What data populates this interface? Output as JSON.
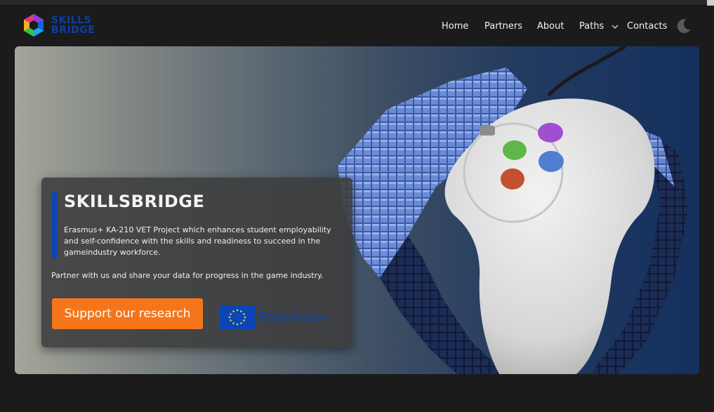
{
  "brand": {
    "line1": "SKILLS",
    "line2": "BRIDGE"
  },
  "nav": {
    "home": "Home",
    "partners": "Partners",
    "about": "About",
    "paths": "Paths",
    "contacts": "Contacts"
  },
  "hero": {
    "title": "SKILLSBRIDGE",
    "description": "Erasmus+ KA-210 VET Project which enhances student employability and self-confidence with the skills and readiness to succeed in the gameindustry workforce.",
    "partner_text": "Partner with us and share your data for progress in the game industry.",
    "cta_label": "Support our research",
    "erasmus_label": "Erasmus+"
  },
  "colors": {
    "accent_orange": "#f5761a",
    "brand_blue": "#0a46b8",
    "background": "#1b1b1b"
  },
  "icons": {
    "theme_toggle": "moon-icon",
    "paths_dropdown": "chevron-down-icon"
  }
}
